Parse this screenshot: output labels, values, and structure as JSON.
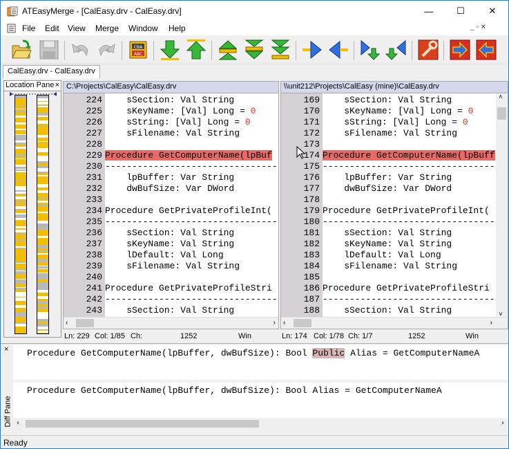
{
  "window": {
    "title": "ATEasyMerge - [CalEasy.drv - CalEasy.drv]",
    "minimize_glyph": "—",
    "maximize_glyph": "☐",
    "close_glyph": "✕"
  },
  "menu": {
    "items": [
      "File",
      "Edit",
      "View",
      "Merge",
      "Window",
      "Help"
    ],
    "mdi_controls": "_ ▫ ✕"
  },
  "toolbar": {
    "buttons": [
      "open-icon",
      "save-icon",
      "undo-icon",
      "redo-icon",
      "spell-check-icon",
      "move-down-icon",
      "move-up-icon",
      "prev-diff-icon",
      "next-diff-icon",
      "last-diff-icon",
      "arrow-right-icon",
      "arrow-left-icon",
      "copy-down-right-icon",
      "copy-down-left-icon",
      "options-icon",
      "merge-right-icon",
      "merge-left-icon"
    ]
  },
  "doc_tab": "CalEasy.drv - CalEasy.drv",
  "location_pane": {
    "title": "Location Pane",
    "close": "×"
  },
  "left_panel": {
    "path": "C:\\Projects\\CalEasy\\CalEasy.drv",
    "lines": [
      {
        "n": "224",
        "t": "    sSection: Val String"
      },
      {
        "n": "225",
        "t": "    sKeyName: [Val] Long = ",
        "r": "0"
      },
      {
        "n": "226",
        "t": "    sString: [Val] Long = ",
        "r": "0"
      },
      {
        "n": "227",
        "t": "    sFilename: Val String"
      },
      {
        "n": "228",
        "t": ""
      },
      {
        "n": "229",
        "t": "Procedure GetComputerName(lpBuf",
        "hl": true
      },
      {
        "n": "230",
        "t": "--------------------------------"
      },
      {
        "n": "231",
        "t": "    lpBuffer: Var String"
      },
      {
        "n": "232",
        "t": "    dwBufSize: Var DWord"
      },
      {
        "n": "233",
        "t": ""
      },
      {
        "n": "234",
        "t": "Procedure GetPrivateProfileInt("
      },
      {
        "n": "235",
        "t": "--------------------------------"
      },
      {
        "n": "236",
        "t": "    sSection: Val String"
      },
      {
        "n": "237",
        "t": "    sKeyName: Val String"
      },
      {
        "n": "238",
        "t": "    lDefault: Val Long"
      },
      {
        "n": "239",
        "t": "    sFilename: Val String"
      },
      {
        "n": "240",
        "t": ""
      },
      {
        "n": "241",
        "t": "Procedure GetPrivateProfileStri"
      },
      {
        "n": "242",
        "t": "--------------------------------"
      },
      {
        "n": "243",
        "t": "    sSection: Val String"
      }
    ],
    "status": {
      "ln": "Ln: 229",
      "col": "Col: 1/85",
      "ch": "Ch:",
      "size": "1252",
      "eol": "Win"
    }
  },
  "right_panel": {
    "path": "\\\\unit212\\Projects\\CalEasy (mine)\\CalEasy.drv",
    "lines": [
      {
        "n": "169",
        "t": "    sSection: Val String"
      },
      {
        "n": "170",
        "t": "    sKeyName: [Val] Long = ",
        "r": "0"
      },
      {
        "n": "171",
        "t": "    sString: [Val] Long = ",
        "r": "0"
      },
      {
        "n": "172",
        "t": "    sFilename: Val String"
      },
      {
        "n": "173",
        "t": ""
      },
      {
        "n": "174",
        "t": "Procedure GetComputerName(lpBuff",
        "hl": true
      },
      {
        "n": "175",
        "t": "--------------------------------"
      },
      {
        "n": "176",
        "t": "    lpBuffer: Var String"
      },
      {
        "n": "177",
        "t": "    dwBufSize: Var DWord"
      },
      {
        "n": "178",
        "t": ""
      },
      {
        "n": "179",
        "t": "Procedure GetPrivateProfileInt("
      },
      {
        "n": "180",
        "t": "--------------------------------"
      },
      {
        "n": "181",
        "t": "    sSection: Val String"
      },
      {
        "n": "182",
        "t": "    sKeyName: Val String"
      },
      {
        "n": "183",
        "t": "    lDefault: Val Long"
      },
      {
        "n": "184",
        "t": "    sFilename: Val String"
      },
      {
        "n": "185",
        "t": ""
      },
      {
        "n": "186",
        "t": "Procedure GetPrivateProfileStri"
      },
      {
        "n": "187",
        "t": "--------------------------------"
      },
      {
        "n": "188",
        "t": "    sSection: Val String"
      }
    ],
    "status": {
      "ln": "Ln: 174",
      "col": "Col: 1/78",
      "ch": "Ch: 1/7",
      "size": "1252",
      "eol": "Win"
    }
  },
  "diff_pane": {
    "label": "Diff Pane",
    "close": "×",
    "line1_before": "Procedure GetComputerName(lpBuffer, dwBufSize): Bool ",
    "line1_highlight": "Public",
    "line1_after": " Alias = GetComputerNameA",
    "line2": "Procedure GetComputerName(lpBuffer, dwBufSize): Bool Alias = GetComputerNameA"
  },
  "status_bar": "Ready",
  "colors": {
    "highlight": "#e76a67",
    "path_bar": "#d4d8ea",
    "gutter": "#d4d0d4",
    "loc_yellow": "#f0c000"
  }
}
